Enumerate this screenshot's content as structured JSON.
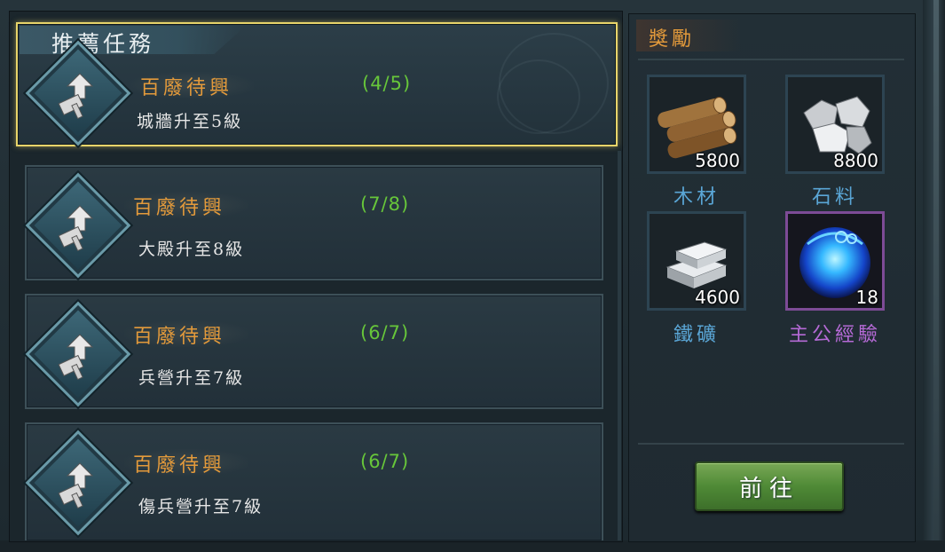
{
  "featured": {
    "header": "推薦任務",
    "name": "百廢待興",
    "progress": "(4/5)",
    "desc": "城牆升至5級"
  },
  "tasks": [
    {
      "name": "百廢待興",
      "progress": "(7/8)",
      "desc": "大殿升至8級"
    },
    {
      "name": "百廢待興",
      "progress": "(6/7)",
      "desc": "兵營升至7級"
    },
    {
      "name": "百廢待興",
      "progress": "(6/7)",
      "desc": "傷兵營升至7級"
    }
  ],
  "reward": {
    "title": "獎勵",
    "items": [
      {
        "icon": "wood-icon",
        "count": "5800",
        "label": "木材"
      },
      {
        "icon": "stone-icon",
        "count": "8800",
        "label": "石料"
      },
      {
        "icon": "iron-ore-icon",
        "count": "4600",
        "label": "鐵礦"
      },
      {
        "icon": "lord-exp-orb-icon",
        "count": "18",
        "label": "主公經驗"
      }
    ]
  },
  "go_button": "前往",
  "colors": {
    "accent_orange": "#e39a3b",
    "progress_green": "#67c63a",
    "highlight_gold": "#e7d46a",
    "label_blue": "#5aa6d6",
    "label_purple": "#b56ad6"
  }
}
